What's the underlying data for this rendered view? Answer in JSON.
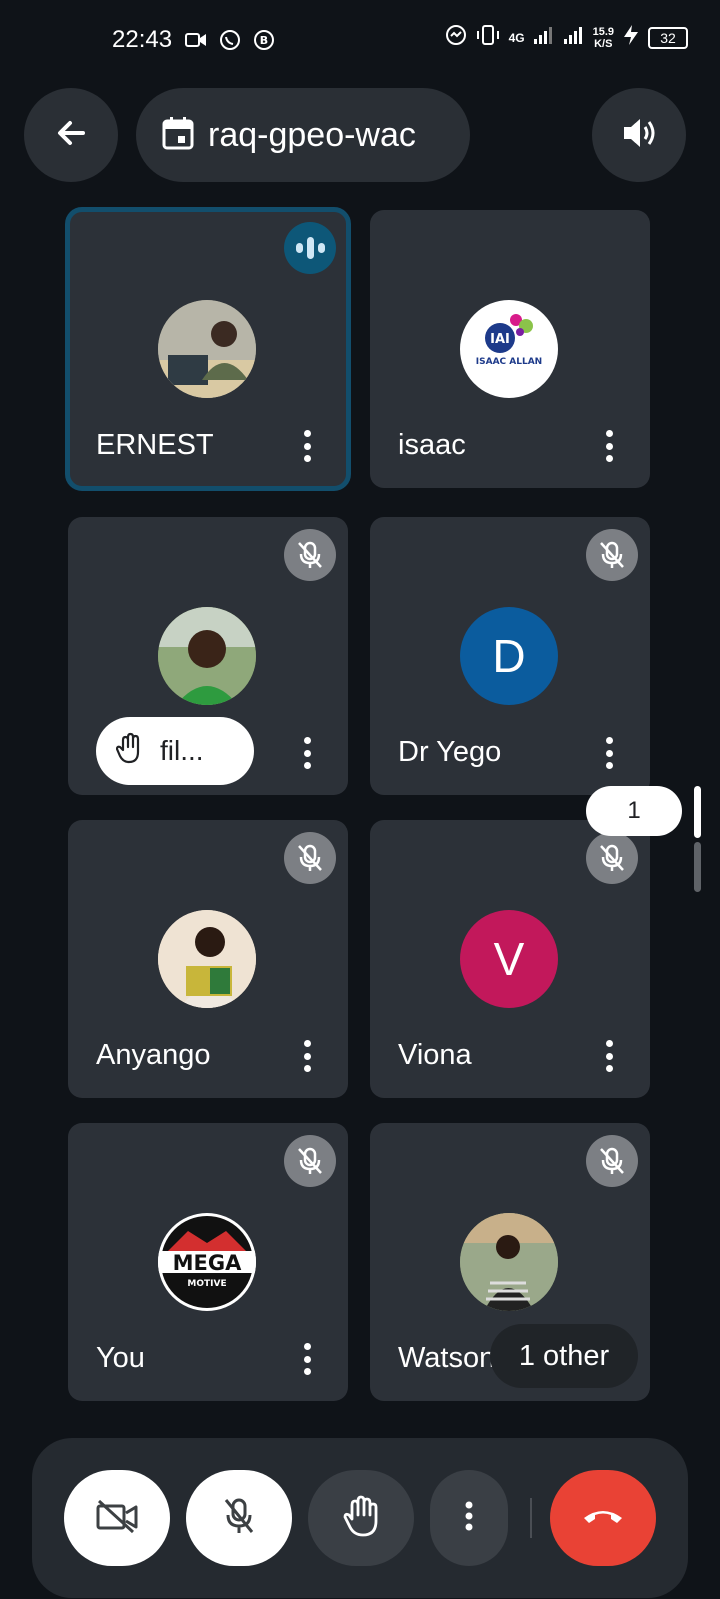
{
  "status_bar": {
    "time": "22:43",
    "network": "4G",
    "net_speed_value": "15.9",
    "net_speed_unit": "K/S",
    "battery": "32"
  },
  "header": {
    "back_icon": "arrow-left-icon",
    "meeting_icon": "calendar-icon",
    "meeting_code": "raq-gpeo-wac",
    "speaker_icon": "speaker-icon"
  },
  "participants": [
    {
      "name": "ERNEST",
      "avatar_type": "photo",
      "status": "speaking",
      "accent": "#124e6c"
    },
    {
      "name": "isaac",
      "avatar_type": "logo",
      "logo_text": "IAI",
      "logo_caption": "ISAAC ALLAN",
      "status": "unmuted"
    },
    {
      "name": "fil...",
      "avatar_type": "photo",
      "status": "muted",
      "hand_raised": true
    },
    {
      "name": "Dr Yego",
      "avatar_type": "letter",
      "letter": "D",
      "color": "#0b5c9e",
      "status": "muted"
    },
    {
      "name": "Anyango",
      "avatar_type": "photo",
      "status": "muted"
    },
    {
      "name": "Viona",
      "avatar_type": "letter",
      "letter": "V",
      "color": "#c2185b",
      "status": "muted"
    },
    {
      "name": "You",
      "avatar_type": "logo",
      "logo_text": "MEGA",
      "logo_caption": "MOTIVE",
      "status": "muted"
    },
    {
      "name": "Watson",
      "avatar_type": "photo",
      "status": "muted"
    }
  ],
  "page_indicator": "1",
  "others_label": "1 other",
  "controls": {
    "camera": "video-off-icon",
    "mic": "mic-off-icon",
    "hand": "raise-hand-icon",
    "more": "more-vert-icon",
    "end_call": "end-call-icon",
    "end_call_color": "#e94235"
  }
}
